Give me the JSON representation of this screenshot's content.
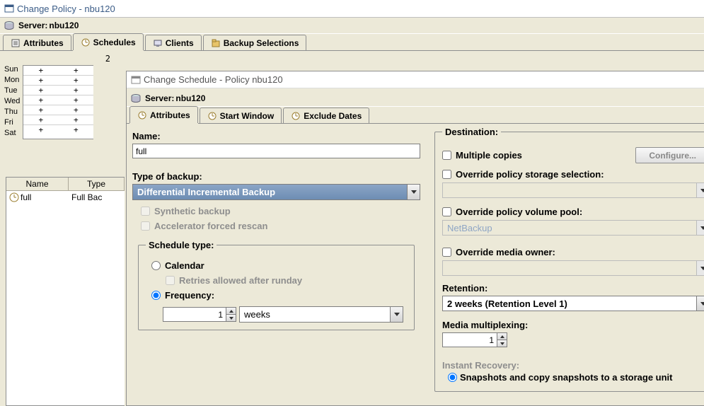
{
  "window": {
    "title": "Change Policy - nbu120"
  },
  "server": {
    "label": "Server:",
    "name": "nbu120"
  },
  "tabs": [
    {
      "label": "Attributes",
      "icon": "attributes"
    },
    {
      "label": "Schedules",
      "icon": "schedules",
      "active": true
    },
    {
      "label": "Clients",
      "icon": "clients"
    },
    {
      "label": "Backup Selections",
      "icon": "selections"
    }
  ],
  "schedule_grid": {
    "header_num": "2",
    "days": [
      "Sun",
      "Mon",
      "Tue",
      "Wed",
      "Thu",
      "Fri",
      "Sat"
    ]
  },
  "schedule_table": {
    "headers": {
      "name": "Name",
      "type": "Type"
    },
    "rows": [
      {
        "name": "full",
        "type": "Full Bac"
      }
    ]
  },
  "nested": {
    "title": "Change Schedule - Policy nbu120",
    "server": {
      "label": "Server:",
      "name": "nbu120"
    },
    "tabs": [
      {
        "label": "Attributes",
        "active": true
      },
      {
        "label": "Start Window"
      },
      {
        "label": "Exclude Dates"
      }
    ],
    "left": {
      "name_label": "Name:",
      "name_value": "full",
      "type_label": "Type of backup:",
      "type_value": "Differential Incremental Backup",
      "synthetic": "Synthetic backup",
      "accelerator": "Accelerator forced rescan",
      "schedule_type_legend": "Schedule type:",
      "calendar": "Calendar",
      "retries": "Retries allowed after runday",
      "frequency": "Frequency:",
      "frequency_value": "1",
      "frequency_unit": "weeks"
    },
    "right": {
      "destination_legend": "Destination:",
      "multiple_copies": "Multiple copies",
      "configure_btn": "Configure...",
      "override_storage": "Override policy storage selection:",
      "storage_value": "",
      "override_volume": "Override policy volume pool:",
      "volume_value": "NetBackup",
      "override_media": "Override media owner:",
      "media_value": "",
      "retention_label": "Retention:",
      "retention_value": "2 weeks (Retention Level 1)",
      "mmp_label": "Media multiplexing:",
      "mmp_value": "1",
      "instant_recovery_label": "Instant Recovery:",
      "ir_option1": "Snapshots and copy snapshots to a storage unit"
    }
  }
}
